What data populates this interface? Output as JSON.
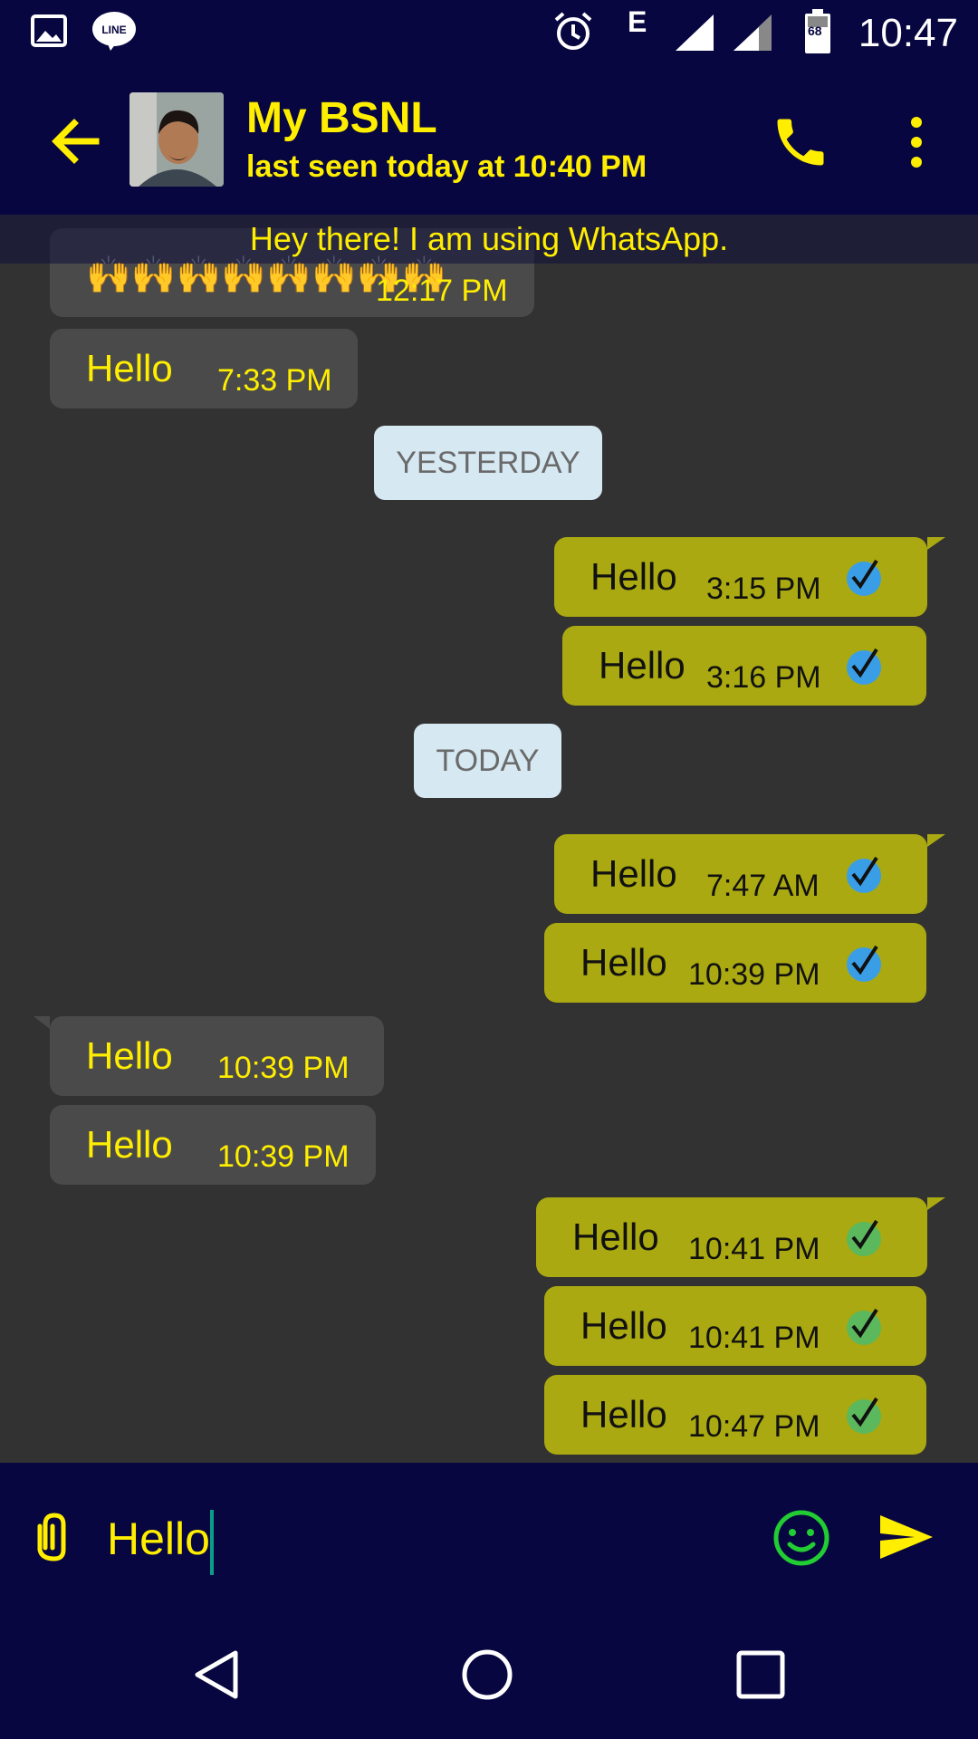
{
  "status_bar": {
    "time": "10:47",
    "network": "E",
    "battery_level": "68",
    "icons": [
      "gallery-icon",
      "line-app-icon",
      "alarm-icon",
      "signal-icon",
      "signal-icon",
      "battery-icon"
    ]
  },
  "header": {
    "contact_name": "My BSNL",
    "last_seen": "last seen today at 10:40 PM",
    "status_message": "Hey there! I am using WhatsApp.",
    "icons": [
      "back-arrow-icon",
      "phone-icon",
      "more-vert-icon"
    ]
  },
  "messages": [
    {
      "type": "in",
      "text": "🙌🙌🙌🙌🙌🙌🙌🙌",
      "time": "12:17 PM"
    },
    {
      "type": "in",
      "text": "Hello",
      "time": "7:33 PM"
    },
    {
      "type": "date",
      "text": "YESTERDAY"
    },
    {
      "type": "out",
      "text": "Hello",
      "time": "3:15 PM",
      "tick": "blue"
    },
    {
      "type": "out",
      "text": "Hello",
      "time": "3:16 PM",
      "tick": "blue"
    },
    {
      "type": "date",
      "text": "TODAY"
    },
    {
      "type": "out",
      "text": "Hello",
      "time": "7:47 AM",
      "tick": "blue"
    },
    {
      "type": "out",
      "text": "Hello",
      "time": "10:39 PM",
      "tick": "blue"
    },
    {
      "type": "in",
      "text": "Hello",
      "time": "10:39 PM"
    },
    {
      "type": "in",
      "text": "Hello",
      "time": "10:39 PM"
    },
    {
      "type": "out",
      "text": "Hello",
      "time": "10:41 PM",
      "tick": "green"
    },
    {
      "type": "out",
      "text": "Hello",
      "time": "10:41 PM",
      "tick": "green"
    },
    {
      "type": "out",
      "text": "Hello",
      "time": "10:47 PM",
      "tick": "green"
    }
  ],
  "composer": {
    "input_value": "Hello",
    "icons": [
      "paperclip-icon",
      "emoji-icon",
      "send-icon"
    ]
  },
  "nav_bar": {
    "icons": [
      "back-triangle-icon",
      "home-circle-icon",
      "recents-square-icon"
    ]
  },
  "colors": {
    "bar_bg": "#070640",
    "chat_bg": "#323232",
    "accent_yellow": "#ffee00",
    "outgoing_bubble": "#aaa911",
    "incoming_bubble": "#4a4a4a",
    "date_pill": "#d6e8f2",
    "tick_blue": "#3a9ee6",
    "tick_green": "#5cb85c",
    "emoji_green": "#22cc33"
  }
}
